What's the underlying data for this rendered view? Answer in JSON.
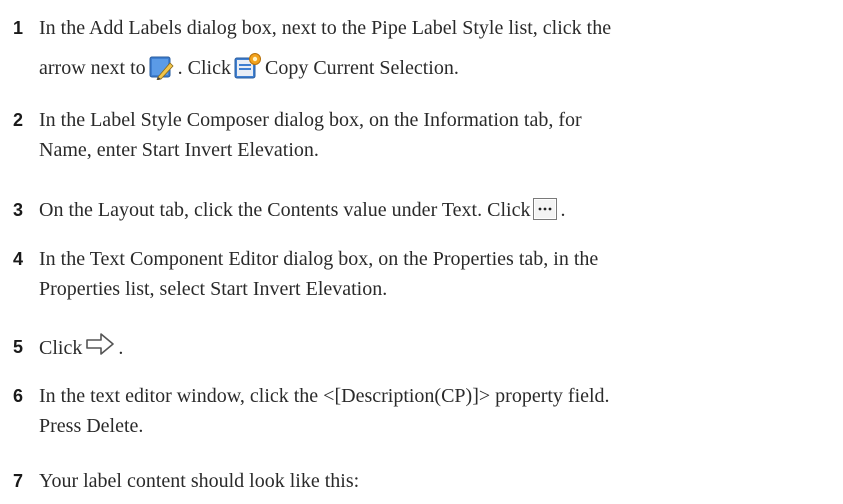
{
  "steps": [
    {
      "number": "1",
      "line1": "In the Add Labels dialog box, next to the Pipe Label Style list, click the",
      "line2_a": "arrow next to",
      "line2_b": ". Click",
      "line2_c": "Copy Current Selection.",
      "icons": [
        "edit-style-icon",
        "copy-current-selection-icon"
      ]
    },
    {
      "number": "2",
      "line1": "In the Label Style Composer dialog box, on the Information tab, for",
      "line2": "Name, enter Start Invert Elevation."
    },
    {
      "number": "3",
      "text_a": "On the Layout tab, click the Contents value under Text. Click",
      "text_b": ".",
      "icons": [
        "ellipsis-button-icon"
      ]
    },
    {
      "number": "4",
      "line1": "In the Text Component Editor dialog box, on the Properties tab, in the",
      "line2": "Properties list, select Start Invert Elevation."
    },
    {
      "number": "5",
      "text_a": "Click",
      "text_b": ".",
      "icons": [
        "right-arrow-icon"
      ]
    },
    {
      "number": "6",
      "line1": "In the text editor window, click the <[Description(CP)]> property field.",
      "line2": "Press Delete."
    },
    {
      "number": "7",
      "line1": "Your label content should look like this:"
    }
  ]
}
